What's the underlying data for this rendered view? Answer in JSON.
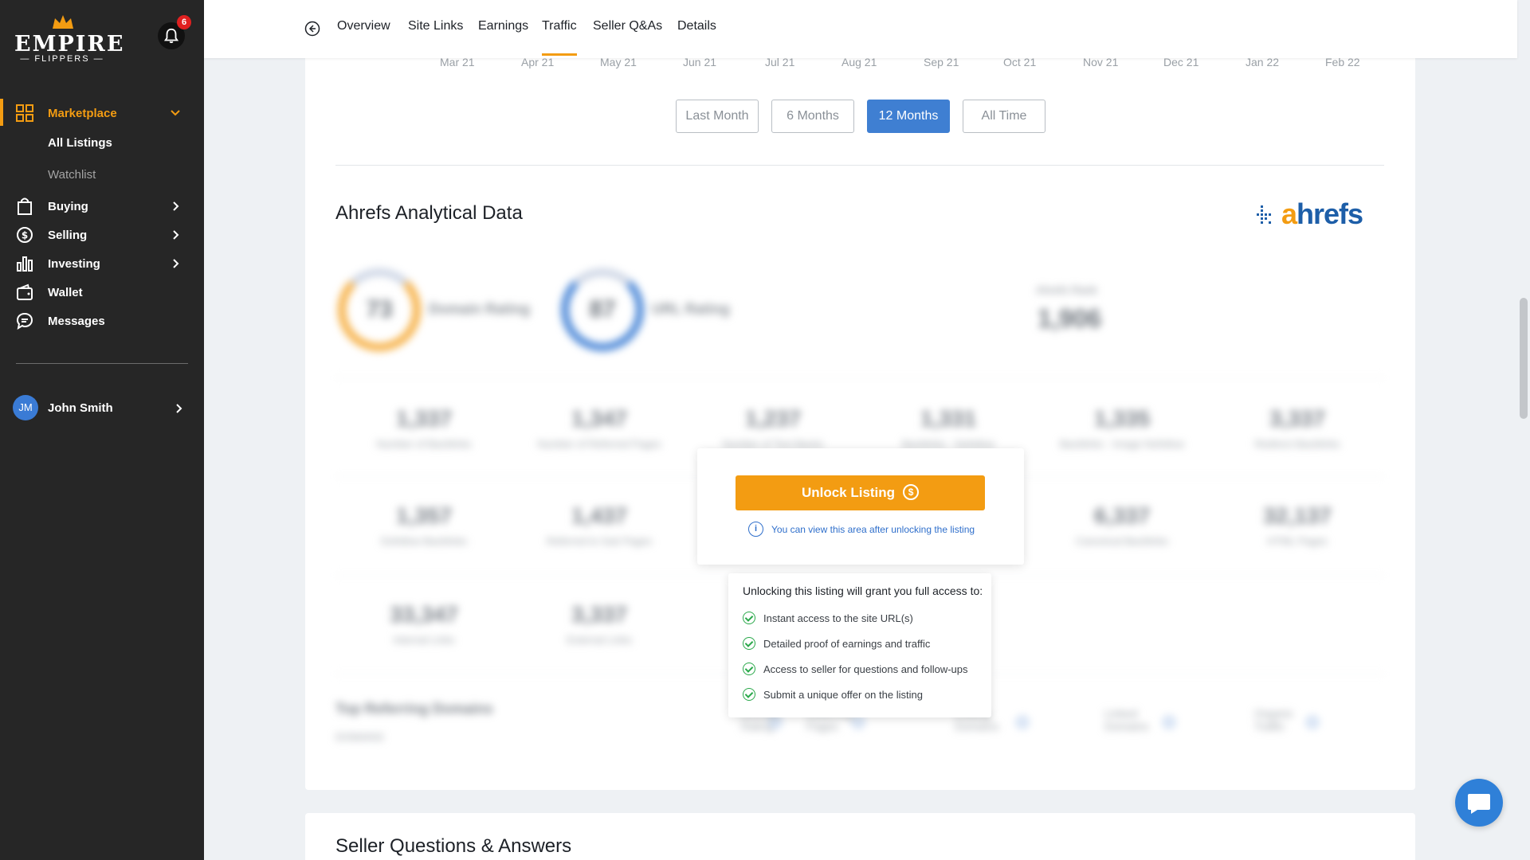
{
  "brand": {
    "name": "EMPIRE",
    "sub": "FLIPPERS"
  },
  "notifications": {
    "count": "6"
  },
  "sidebar": {
    "marketplace": "Marketplace",
    "sub_items": [
      "All Listings",
      "Watchlist"
    ],
    "items": [
      "Buying",
      "Selling",
      "Investing",
      "Wallet",
      "Messages"
    ]
  },
  "user": {
    "initials": "JM",
    "name": "John Smith"
  },
  "tabs": [
    "Overview",
    "Site Links",
    "Earnings",
    "Traffic",
    "Seller Q&As",
    "Details"
  ],
  "active_tab": "Traffic",
  "chart": {
    "months": [
      "Mar 21",
      "Apr 21",
      "May 21",
      "Jun 21",
      "Jul 21",
      "Aug 21",
      "Sep 21",
      "Oct 21",
      "Nov 21",
      "Dec 21",
      "Jan 22",
      "Feb 22"
    ]
  },
  "range_buttons": [
    "Last Month",
    "6 Months",
    "12 Months",
    "All Time"
  ],
  "active_range": "12 Months",
  "ahrefs": {
    "title": "Ahrefs Analytical Data",
    "logo": "ahrefs",
    "domain_rating": {
      "value": "73",
      "label": "Domain Rating"
    },
    "url_rating": {
      "value": "87",
      "label": "URL Rating"
    },
    "ahrefs_rank": {
      "label": "Ahrefs Rank",
      "value": "1,906"
    },
    "stats_row1": [
      {
        "value": "1,337",
        "label": "Number of Backlinks"
      },
      {
        "value": "1,347",
        "label": "Number of Referred Pages"
      },
      {
        "value": "1,237",
        "label": "Number of Text Backs"
      },
      {
        "value": "1,331",
        "label": "Backlinks - Nofollow"
      },
      {
        "value": "1,335",
        "label": "Backlinks - Image Nofollow"
      },
      {
        "value": "3,337",
        "label": "Redirect Backlinks"
      }
    ],
    "stats_row2": [
      {
        "value": "1,357",
        "label": "Dofollow Backlinks"
      },
      {
        "value": "1,437",
        "label": "Referred to Sub Pages"
      },
      {
        "value": "6,337",
        "label": "Canonical Backlinks"
      },
      {
        "value": "32,137",
        "label": "HTML Pages"
      }
    ],
    "stats_row3": [
      {
        "value": "33,347",
        "label": "Internal Links"
      },
      {
        "value": "3,337",
        "label": "External Links"
      }
    ],
    "referring": {
      "title": "Top Referring Domains",
      "sub": "DOMAINS",
      "columns": [
        "Domain Rating",
        "Referring Pages",
        "Linking Domains",
        "Linked Domains",
        "Organic Traffic"
      ]
    }
  },
  "unlock": {
    "button": "Unlock Listing",
    "coin": "$",
    "note": "You can view this area after unlocking the listing",
    "access_title": "Unlocking this listing will grant you full access to:",
    "access_items": [
      "Instant access to the site URL(s)",
      "Detailed proof of earnings and traffic",
      "Access to seller for questions and follow-ups",
      "Submit a unique offer on the listing"
    ]
  },
  "seller_qa": {
    "title": "Seller Questions & Answers"
  }
}
